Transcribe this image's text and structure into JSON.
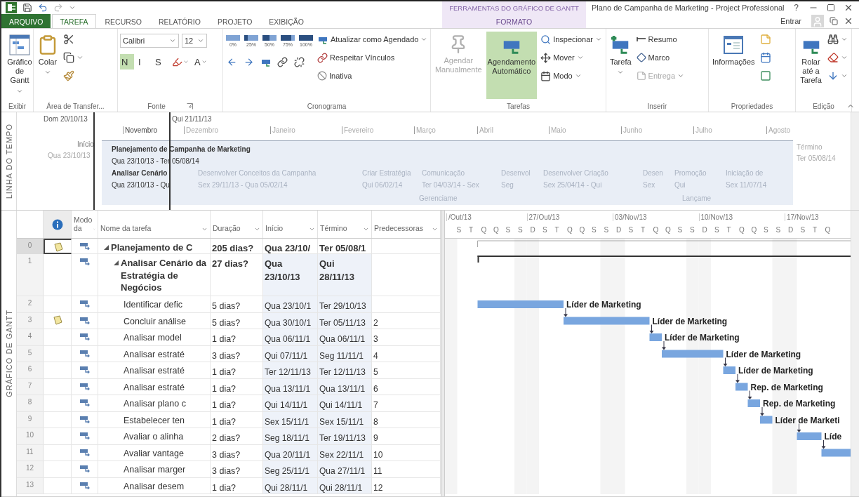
{
  "window": {
    "title": "Plano de Campanha de Marketing - Project Professional",
    "help": "?",
    "contextual_group": "FERRAMENTAS DO GRÁFICO DE GANTT"
  },
  "account": {
    "sign_in": "Entrar"
  },
  "tabs": [
    {
      "label": "ARQUIVO",
      "kind": "file",
      "selected": false
    },
    {
      "label": "TAREFA",
      "kind": "tab",
      "selected": true
    },
    {
      "label": "RECURSO",
      "kind": "tab",
      "selected": false
    },
    {
      "label": "RELATÓRIO",
      "kind": "tab",
      "selected": false
    },
    {
      "label": "PROJETO",
      "kind": "tab",
      "selected": false
    },
    {
      "label": "EXIBIÇÃO",
      "kind": "tab",
      "selected": false
    },
    {
      "label": "FORMATO",
      "kind": "contextual",
      "selected": false
    }
  ],
  "ribbon": [
    {
      "label": "Exibir",
      "columns": [
        [
          {
            "kind": "large",
            "label": "Gráfico de Gantt",
            "dropdown": true
          }
        ]
      ]
    },
    {
      "label": "Área de Transfer...",
      "columns": [
        [
          {
            "kind": "large",
            "label": "Colar",
            "dropdown": true
          }
        ],
        [
          {
            "kind": "small",
            "dropdown": false
          },
          {
            "kind": "small",
            "dropdown": true
          },
          {
            "kind": "small",
            "dropdown": false
          }
        ]
      ]
    },
    {
      "label": "Fonte",
      "launcher": true,
      "columns": [
        [
          {
            "kind": "row",
            "items": [
              {
                "kind": "combo",
                "value": "Calibri"
              },
              {
                "kind": "combo",
                "value": "12"
              }
            ]
          },
          {
            "kind": "row",
            "items": [
              {
                "kind": "icon",
                "label": "N",
                "selected": true,
                "dropdown": false
              },
              {
                "kind": "icon",
                "label": "I",
                "selected": false,
                "dropdown": false
              },
              {
                "kind": "icon",
                "label": "S",
                "selected": false,
                "dropdown": false
              },
              {
                "kind": "icon",
                "selected": false,
                "dropdown": true
              },
              {
                "kind": "icon",
                "label": "A",
                "selected": false,
                "dropdown": true
              }
            ]
          }
        ]
      ]
    },
    {
      "label": "Cronograma",
      "columns": [
        [
          {
            "kind": "row",
            "items": [
              {
                "kind": "pct",
                "label": "0%"
              },
              {
                "kind": "pct",
                "label": "25%"
              },
              {
                "kind": "pct",
                "label": "50%"
              },
              {
                "kind": "pct",
                "label": "75%"
              },
              {
                "kind": "pct",
                "label": "100%"
              }
            ]
          },
          {
            "kind": "row",
            "items": [
              {
                "kind": "icon",
                "dropdown": false
              },
              {
                "kind": "icon",
                "dropdown": false
              },
              {
                "kind": "icon",
                "dropdown": false
              },
              {
                "kind": "icon",
                "dropdown": false
              },
              {
                "kind": "icon",
                "dropdown": false
              }
            ]
          }
        ],
        [
          {
            "kind": "small",
            "label": "Atualizar como Agendado",
            "dropdown": true
          },
          {
            "kind": "small",
            "label": "Respeitar Vínculos",
            "dropdown": false
          },
          {
            "kind": "small",
            "label": "Inativa",
            "dropdown": false
          }
        ]
      ]
    },
    {
      "label": "Tarefas",
      "columns": [
        [
          {
            "kind": "large",
            "label": "Agendar Manualmente",
            "dropdown": false,
            "disabled": true,
            "selected": false
          }
        ],
        [
          {
            "kind": "large",
            "label": "Agendamento Automático",
            "dropdown": false,
            "disabled": false,
            "selected": true
          }
        ],
        [
          {
            "kind": "small",
            "label": "Inspecionar",
            "dropdown": true
          },
          {
            "kind": "small",
            "label": "Mover",
            "dropdown": true
          },
          {
            "kind": "small",
            "label": "Modo",
            "dropdown": true
          }
        ]
      ]
    },
    {
      "label": "Inserir",
      "columns": [
        [
          {
            "kind": "large",
            "label": "Tarefa",
            "dropdown": true
          }
        ],
        [
          {
            "kind": "small",
            "label": "Resumo",
            "dropdown": false,
            "disabled": false
          },
          {
            "kind": "small",
            "label": "Marco",
            "dropdown": false,
            "disabled": false
          },
          {
            "kind": "small",
            "label": "Entrega",
            "dropdown": true,
            "disabled": true
          }
        ]
      ]
    },
    {
      "label": "Propriedades",
      "columns": [
        [
          {
            "kind": "large",
            "label": "Informações",
            "dropdown": false
          }
        ],
        [
          {
            "kind": "small",
            "dropdown": false
          },
          {
            "kind": "small",
            "dropdown": false
          },
          {
            "kind": "small",
            "dropdown": false
          }
        ]
      ]
    },
    {
      "label": "Edição",
      "columns": [
        [
          {
            "kind": "large",
            "label": "Rolar até a Tarefa",
            "dropdown": false
          }
        ],
        [
          {
            "kind": "small",
            "dropdown": true
          },
          {
            "kind": "small",
            "dropdown": true
          },
          {
            "kind": "small",
            "dropdown": true
          }
        ]
      ]
    }
  ],
  "timeline": {
    "label": "LINHA DO TEMPO",
    "view_start": "Dom 20/10/13",
    "view_end": "Qui 21/11/13",
    "months": [
      "Novembro",
      "Dezembro",
      "Janeiro",
      "Fevereiro",
      "Março",
      "Abril",
      "Maio",
      "Junho",
      "Julho",
      "Agosto"
    ],
    "start": {
      "label": "Início",
      "date": "Qua 23/10/13"
    },
    "finish": {
      "label": "Término",
      "date": "Ter 05/08/14"
    },
    "items": [
      {
        "name": "Planejamento de Campanha de Marketing",
        "dates": "Qua 23/10/13 - Ter 05/08/14",
        "in_view": true
      },
      {
        "name": "Analisar Cenário",
        "dates": "Qua 23/10/13 - Qu",
        "in_view": true
      },
      {
        "name": "Desenvolver Conceitos da Campanha",
        "dates": "Sex 29/11/13 - Qua 05/02/14",
        "in_view": false
      },
      {
        "name": "Criar Estratégia",
        "dates": "Qui 06/02/14",
        "in_view": false
      },
      {
        "name": "Comunicação",
        "dates": "Ter 04/03/14 - Sex",
        "in_view": false
      },
      {
        "name": "Desenvol",
        "dates": "Seg",
        "in_view": false
      },
      {
        "name": "Desenvolver Criação",
        "dates": "Sex 25/04/14 - Qui",
        "in_view": false
      },
      {
        "name": "Desen",
        "dates": "Sex",
        "in_view": false
      },
      {
        "name": "Promoção",
        "dates": "Qui",
        "in_view": false
      },
      {
        "name": "Iniciação de",
        "dates": "Sex 11/07/14",
        "in_view": false
      }
    ],
    "callouts": [
      "Gerenciame",
      "Lançame"
    ]
  },
  "gantt": {
    "label": "GRÁFICO DE GANTT",
    "columns": [
      "Modo da",
      "Nome da tarefa",
      "Duração",
      "Início",
      "Término",
      "Predecessoras"
    ],
    "weeks": [
      "/Out/13",
      "27/Out/13",
      "03/Nov/13",
      "10/Nov/13",
      "17/Nov/13"
    ],
    "days": [
      "S",
      "T",
      "Q",
      "Q",
      "S",
      "S",
      "D",
      "S",
      "T",
      "Q",
      "Q",
      "S",
      "S",
      "D",
      "S",
      "T",
      "Q",
      "Q",
      "S",
      "S",
      "D",
      "S",
      "T",
      "Q",
      "Q",
      "S",
      "S",
      "D",
      "S",
      "T",
      "Q"
    ]
  },
  "tasks": [
    {
      "id": "0",
      "name": "Planejamento de C",
      "duration": "205 dias?",
      "start": "Qua 23/10/",
      "finish": "Ter 05/08/1",
      "has_note": true,
      "selected": true,
      "expanded": true,
      "children": [
        {
          "id": "1",
          "name": "Analisar Cenário da Estratégia de Negócios",
          "duration": "27 dias?",
          "start": "Qua 23/10/13",
          "finish": "Qui 28/11/13",
          "has_note": false,
          "selected": false,
          "expanded": true,
          "children": [
            {
              "id": "2",
              "name": "Identificar defic",
              "duration": "5 dias?",
              "start": "Qua 23/10/1",
              "finish": "Ter 29/10/13",
              "has_note": false,
              "selected": false,
              "bar_label": "Líder de Marketing"
            },
            {
              "id": "3",
              "name": "Concluir análise",
              "duration": "5 dias?",
              "start": "Qua 30/10/1",
              "finish": "Ter 05/11/13",
              "predecessors": "2",
              "has_note": true,
              "selected": false,
              "bar_label": "Líder de Marketing"
            },
            {
              "id": "4",
              "name": "Analisar model",
              "duration": "1 dia?",
              "start": "Qua 06/11/1",
              "finish": "Qua 06/11/1",
              "predecessors": "3",
              "has_note": false,
              "selected": false,
              "bar_label": "Líder de Marketing"
            },
            {
              "id": "5",
              "name": "Analisar estraté",
              "duration": "3 dias?",
              "start": "Qui 07/11/1",
              "finish": "Seg 11/11/1",
              "predecessors": "4",
              "has_note": false,
              "selected": false,
              "bar_label": "Líder de Marketing"
            },
            {
              "id": "6",
              "name": "Analisar estraté",
              "duration": "1 dia?",
              "start": "Ter 12/11/13",
              "finish": "Ter 12/11/13",
              "predecessors": "5",
              "has_note": false,
              "selected": false,
              "bar_label": "Líder de Marketing"
            },
            {
              "id": "7",
              "name": "Analisar estraté",
              "duration": "1 dia?",
              "start": "Qua 13/11/1",
              "finish": "Qua 13/11/1",
              "predecessors": "6",
              "has_note": false,
              "selected": false,
              "bar_label": "Rep. de Marketing"
            },
            {
              "id": "8",
              "name": "Analisar plano c",
              "duration": "1 dia?",
              "start": "Qui 14/11/1",
              "finish": "Qui 14/11/1",
              "predecessors": "7",
              "has_note": false,
              "selected": false,
              "bar_label": "Rep. de Marketing"
            },
            {
              "id": "9",
              "name": "Estabelecer ten",
              "duration": "1 dia?",
              "start": "Sex 15/11/1",
              "finish": "Sex 15/11/1",
              "predecessors": "8",
              "has_note": false,
              "selected": false,
              "bar_label": "Líder de Marketi"
            },
            {
              "id": "10",
              "name": "Avaliar o alinha",
              "duration": "2 dias?",
              "start": "Seg 18/11/1",
              "finish": "Ter 19/11/13",
              "predecessors": "9",
              "has_note": false,
              "selected": false,
              "bar_label": "Líde"
            },
            {
              "id": "11",
              "name": "Avaliar vantage",
              "duration": "3 dias?",
              "start": "Qua 20/11/1",
              "finish": "Sex 22/11/1",
              "predecessors": "10",
              "has_note": false,
              "selected": false
            },
            {
              "id": "12",
              "name": "Analisar marger",
              "duration": "3 dias?",
              "start": "Seg 25/11/1",
              "finish": "Qua 27/11/1",
              "predecessors": "11",
              "has_note": false,
              "selected": false
            },
            {
              "id": "13",
              "name": "Analisar desem",
              "duration": "1 dia?",
              "start": "Qui 28/11/1",
              "finish": "Qui 28/11/1",
              "predecessors": "12",
              "has_note": false,
              "selected": false
            }
          ]
        }
      ]
    }
  ]
}
